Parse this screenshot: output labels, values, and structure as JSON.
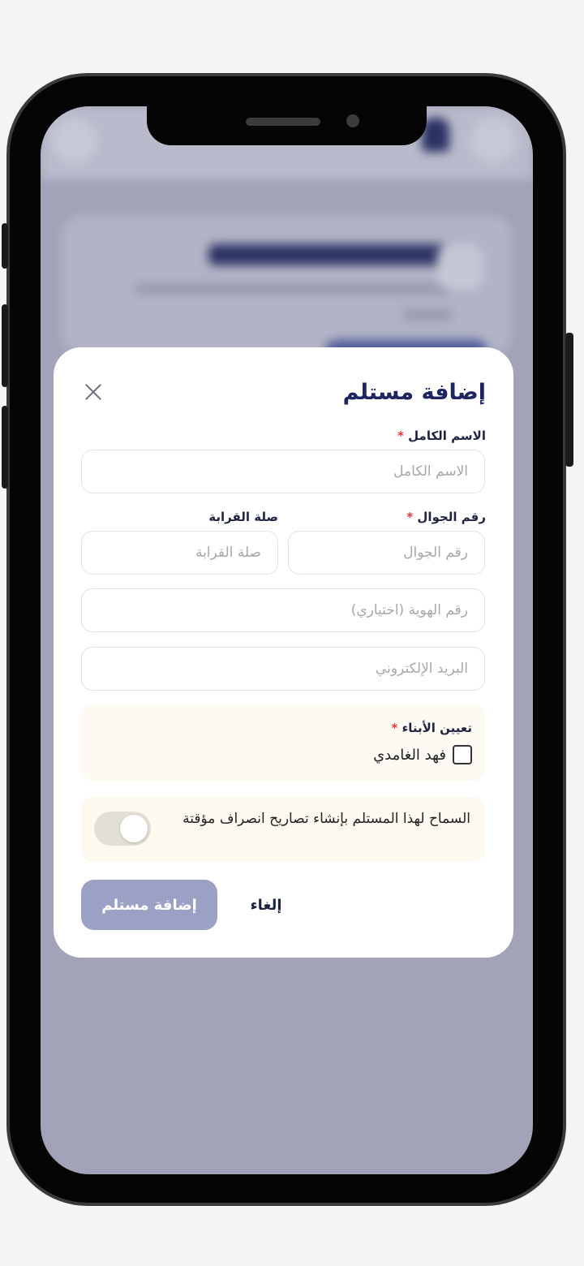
{
  "modal": {
    "title": "إضافة مستلم",
    "full_name": {
      "label": "الاسم الكامل",
      "required": "*",
      "placeholder": "الاسم الكامل",
      "value": ""
    },
    "mobile": {
      "label": "رقم الجوال",
      "required": "*",
      "placeholder": "رقم الجوال",
      "value": ""
    },
    "relation": {
      "label": "صلة القرابة",
      "placeholder": "صلة القرابة",
      "value": ""
    },
    "id_number": {
      "placeholder": "رقم الهوية (اختياري)",
      "value": ""
    },
    "email": {
      "placeholder": "البريد الإلكتروني",
      "value": ""
    },
    "children": {
      "label": "تعيين الأبناء",
      "required": "*",
      "items": [
        {
          "name": "فهد الغامدي",
          "checked": false
        }
      ]
    },
    "permission": {
      "text": "السماح لهذا المستلم بإنشاء تصاريح انصراف مؤقتة",
      "enabled": false
    },
    "add_button": "إضافة مستلم",
    "cancel_button": "إلغاء"
  },
  "colors": {
    "title": "#1f2560",
    "primary_button": "#9aa1c4",
    "required": "#e53935",
    "overlay": "#a2a3b9"
  }
}
